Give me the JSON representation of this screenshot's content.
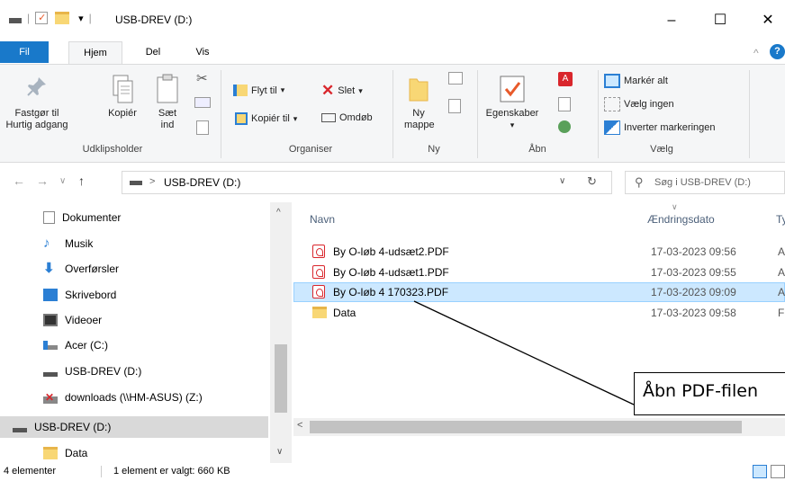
{
  "window": {
    "title": "USB-DREV (D:)",
    "minimize_glyph": "–",
    "maximize_glyph": "☐",
    "close_glyph": "✕",
    "quickaccess_separator": "|",
    "quickaccess_dropdown": "▾"
  },
  "ribbon_tabs": [
    {
      "label": "Fil"
    },
    {
      "label": "Hjem"
    },
    {
      "label": "Del"
    },
    {
      "label": "Vis"
    }
  ],
  "ribbon": {
    "clipboard": {
      "pin_label": "Fastgør til Hurtig adgang",
      "copy_label": "Kopiér",
      "paste_label": "Sæt ind",
      "group_label": "Udklipsholder"
    },
    "organize": {
      "move_label": "Flyt til",
      "copy_to_label": "Kopiér til",
      "delete_label": "Slet",
      "rename_label": "Omdøb",
      "group_label": "Organiser"
    },
    "new": {
      "new_folder_label": "Ny mappe",
      "group_label": "Ny"
    },
    "open": {
      "properties_label": "Egenskaber",
      "group_label": "Åbn"
    },
    "select": {
      "select_all_label": "Markér alt",
      "select_none_label": "Vælg ingen",
      "invert_label": "Inverter markeringen",
      "group_label": "Vælg"
    }
  },
  "address_bar": {
    "path": "USB-DREV (D:)",
    "separator": ">",
    "search_placeholder": "Søg i USB-DREV (D:)"
  },
  "nav_pane": {
    "items": [
      {
        "label": "Dokumenter",
        "icon": "documents-icon"
      },
      {
        "label": "Musik",
        "icon": "music-icon"
      },
      {
        "label": "Overførsler",
        "icon": "downloads-icon"
      },
      {
        "label": "Skrivebord",
        "icon": "desktop-icon"
      },
      {
        "label": "Videoer",
        "icon": "videos-icon"
      },
      {
        "label": "Acer (C:)",
        "icon": "drive-c-icon"
      },
      {
        "label": "USB-DREV (D:)",
        "icon": "usb-drive-icon"
      },
      {
        "label": "downloads (\\\\HM-ASUS) (Z:)",
        "icon": "network-drive-icon"
      },
      {
        "label": "USB-DREV (D:)",
        "icon": "usb-drive-icon"
      },
      {
        "label": "Data",
        "icon": "folder-icon"
      }
    ]
  },
  "file_list": {
    "columns": {
      "name": "Navn",
      "date": "Ændringsdato",
      "type": "Ty"
    },
    "rows": [
      {
        "name": "By O-løb 4-udsæt2.PDF",
        "date": "17-03-2023 09:56",
        "type": "A",
        "kind": "pdf"
      },
      {
        "name": "By O-løb 4-udsæt1.PDF",
        "date": "17-03-2023 09:55",
        "type": "A",
        "kind": "pdf"
      },
      {
        "name": "By O-løb 4 170323.PDF",
        "date": "17-03-2023 09:09",
        "type": "A",
        "kind": "pdf",
        "selected": true
      },
      {
        "name": "Data",
        "date": "17-03-2023 09:58",
        "type": "Fi",
        "kind": "folder"
      }
    ]
  },
  "status_bar": {
    "item_count": "4 elementer",
    "selection": "1 element er valgt: 660 KB"
  },
  "callout": {
    "text": "Åbn PDF-filen"
  },
  "colors": {
    "accent": "#1979ca",
    "selection": "#cce8ff",
    "pdf_red": "#d9262c",
    "folder_yellow": "#f8d775"
  }
}
